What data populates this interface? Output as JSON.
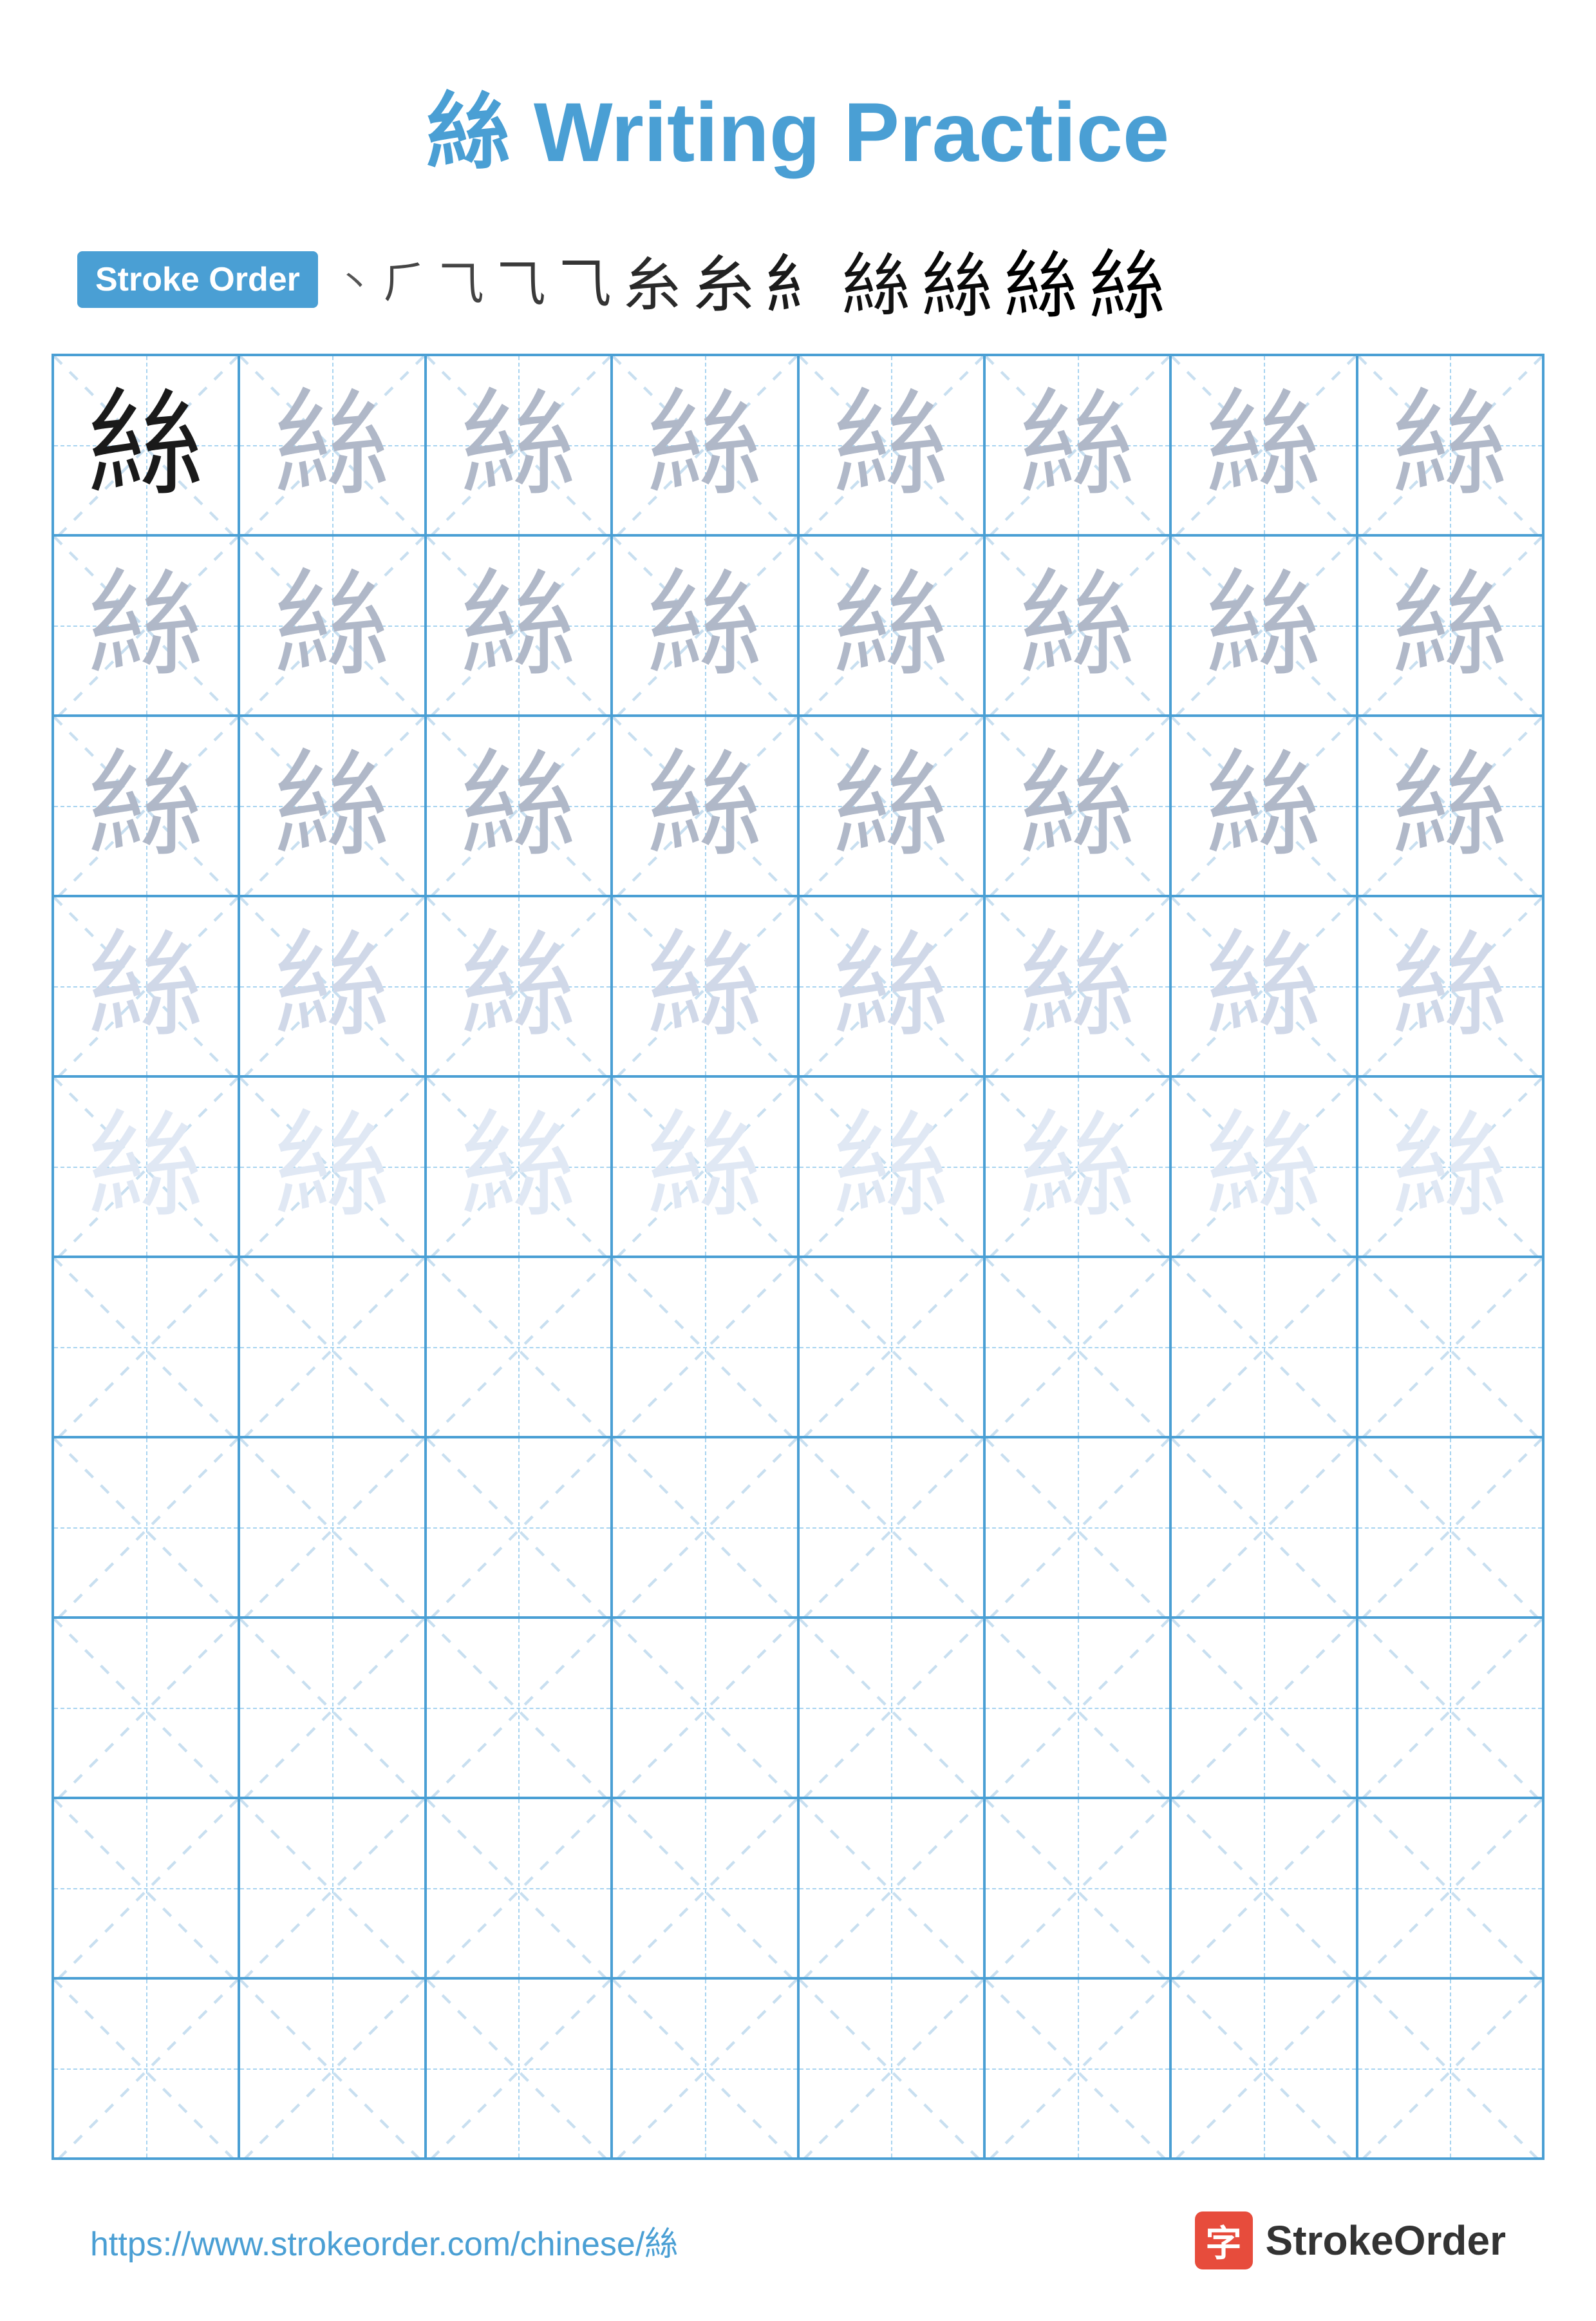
{
  "title": {
    "char": "絲",
    "text": " Writing Practice",
    "full": "絲 Writing Practice"
  },
  "stroke_order": {
    "badge_label": "Stroke Order",
    "strokes": [
      "⼂",
      "⺄",
      "⺄",
      "⺄",
      "⺄",
      "⺄",
      "⿺",
      "糹",
      "糹",
      "絲",
      "絲",
      "絲"
    ]
  },
  "grid": {
    "rows": 10,
    "cols": 8,
    "char": "絲"
  },
  "footer": {
    "url": "https://www.strokeorder.com/chinese/絲",
    "logo_text": "StrokeOrder",
    "logo_char": "字"
  }
}
